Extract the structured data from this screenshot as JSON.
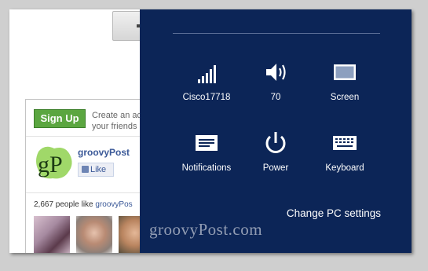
{
  "background_page": {
    "signup": {
      "button_label": "Sign Up",
      "text_line1": "Create an ac",
      "text_line2": "your friends"
    },
    "fb_page": {
      "name": "groovyPost",
      "logo_text": "gP",
      "like_label": "Like",
      "people_like_prefix": "2,667 people like ",
      "people_like_link": "groovyPos"
    }
  },
  "charm": {
    "tiles": [
      {
        "label": "Cisco17718",
        "icon": "wifi-signal-icon"
      },
      {
        "label": "70",
        "icon": "speaker-volume-icon"
      },
      {
        "label": "Screen",
        "icon": "screen-brightness-icon"
      },
      {
        "label": "Notifications",
        "icon": "notifications-icon"
      },
      {
        "label": "Power",
        "icon": "power-icon"
      },
      {
        "label": "Keyboard",
        "icon": "keyboard-icon"
      }
    ],
    "change_pc_settings": "Change PC settings",
    "background_color": "#0c2557"
  },
  "watermark": "groovyPost.com",
  "colors": {
    "signup_green": "#5ba640",
    "facebook_blue": "#3b5998"
  }
}
